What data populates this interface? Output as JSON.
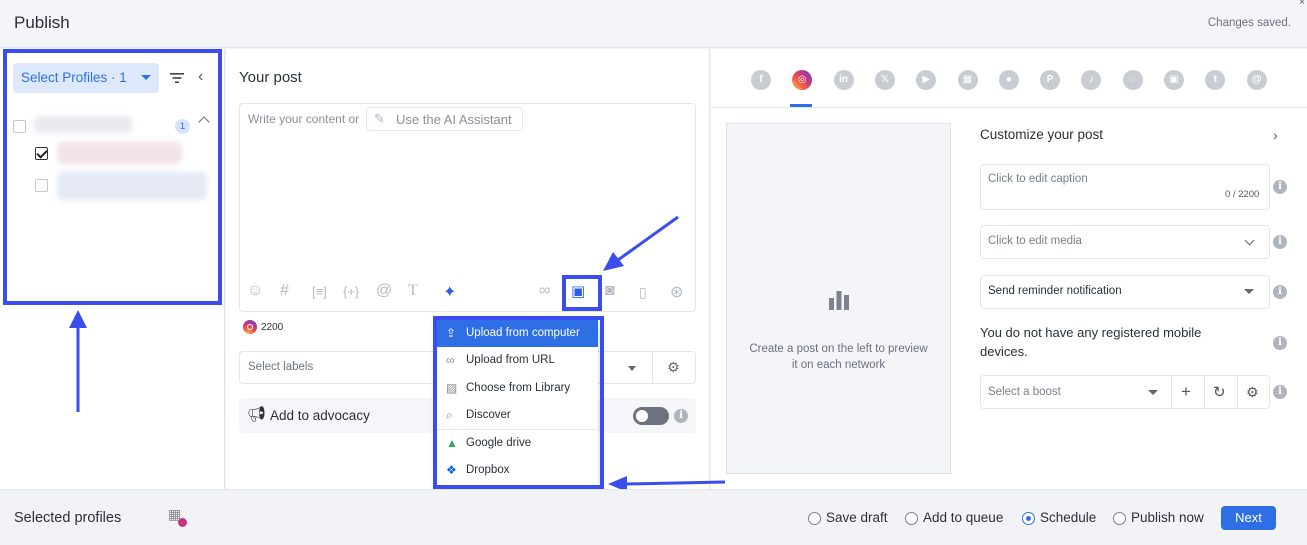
{
  "header": {
    "title": "Publish",
    "status": "Changes saved.",
    "close": "×"
  },
  "profiles": {
    "select_label": "Select Profiles · 1",
    "group_count": "1"
  },
  "editor": {
    "heading": "Your post",
    "placeholder": "Write your content or",
    "ai_button": "Use the AI Assistant",
    "char_count": "2200",
    "labels_placeholder": "Select labels",
    "advocacy_label": "Add to advocacy",
    "advocacy_enabled": false
  },
  "media_menu": {
    "items": [
      {
        "label": "Upload from computer",
        "icon": "upload-icon"
      },
      {
        "label": "Upload from URL",
        "icon": "link-icon"
      },
      {
        "label": "Choose from Library",
        "icon": "image-icon"
      },
      {
        "label": "Discover",
        "icon": "search-icon"
      },
      {
        "label": "Google drive",
        "icon": "google-drive-icon"
      },
      {
        "label": "Dropbox",
        "icon": "dropbox-icon"
      }
    ]
  },
  "networks": [
    {
      "name": "facebook",
      "glyph": "f"
    },
    {
      "name": "instagram",
      "glyph": "◎"
    },
    {
      "name": "linkedin",
      "glyph": "in"
    },
    {
      "name": "x",
      "glyph": "𝕏"
    },
    {
      "name": "youtube",
      "glyph": "▶"
    },
    {
      "name": "google-business",
      "glyph": "▦"
    },
    {
      "name": "reddit",
      "glyph": "●"
    },
    {
      "name": "pinterest",
      "glyph": "P"
    },
    {
      "name": "tiktok",
      "glyph": "♪"
    },
    {
      "name": "snapchat",
      "glyph": "◌"
    },
    {
      "name": "facebook-group",
      "glyph": "▣"
    },
    {
      "name": "tumblr",
      "glyph": "t"
    },
    {
      "name": "threads",
      "glyph": "@"
    }
  ],
  "preview": {
    "empty_text": "Create a post on the left to preview it on each network"
  },
  "customize": {
    "title": "Customize your post",
    "caption_placeholder": "Click to edit caption",
    "caption_count": "0 / 2200",
    "media_placeholder": "Click to edit media",
    "reminder": "Send reminder notification",
    "no_devices": "You do not have any registered mobile devices.",
    "boost_placeholder": "Select a boost"
  },
  "footer": {
    "selected_profiles": "Selected profiles",
    "options": [
      "Save draft",
      "Add to queue",
      "Schedule",
      "Publish now"
    ],
    "selected_option": "Schedule",
    "next": "Next"
  },
  "colors": {
    "accent": "#2f6fe6",
    "annotation": "#3a4ef0"
  }
}
